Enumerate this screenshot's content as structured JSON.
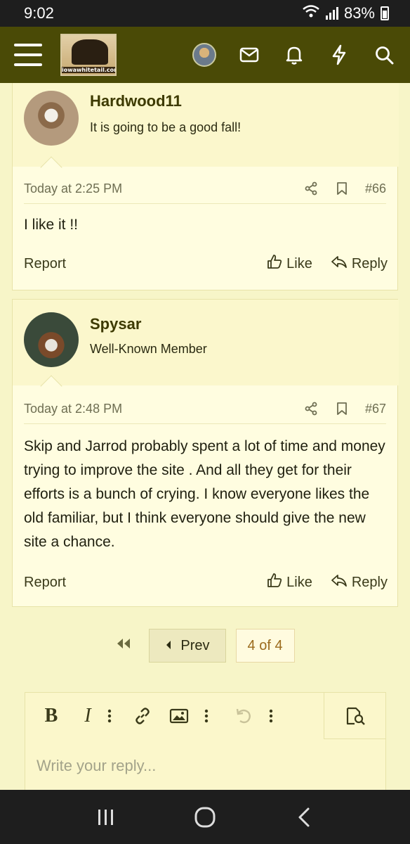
{
  "status_bar": {
    "time": "9:02",
    "battery": "83%"
  },
  "header": {
    "logo_text": "iowawhitetail.com"
  },
  "posts": [
    {
      "username": "Hardwood11",
      "user_title": "It is going to be a good fall!",
      "date": "Today at 2:25 PM",
      "post_number": "#66",
      "body": "I like it !!",
      "report_label": "Report",
      "like_label": "Like",
      "reply_label": "Reply"
    },
    {
      "username": "Spysar",
      "user_title": "Well-Known Member",
      "date": "Today at 2:48 PM",
      "post_number": "#67",
      "body": "Skip and Jarrod probably spent a lot of time and money trying to improve the site . And all they get for their efforts is a bunch of crying. I know everyone likes the old familiar, but I think everyone should give the new site a chance.",
      "report_label": "Report",
      "like_label": "Like",
      "reply_label": "Reply"
    }
  ],
  "pagination": {
    "prev_label": "Prev",
    "current": "4 of 4"
  },
  "editor": {
    "placeholder": "Write your reply..."
  },
  "colors": {
    "header_bg": "#4a4a06",
    "page_bg": "#f7f5c8",
    "accent": "#9b6b1d"
  }
}
